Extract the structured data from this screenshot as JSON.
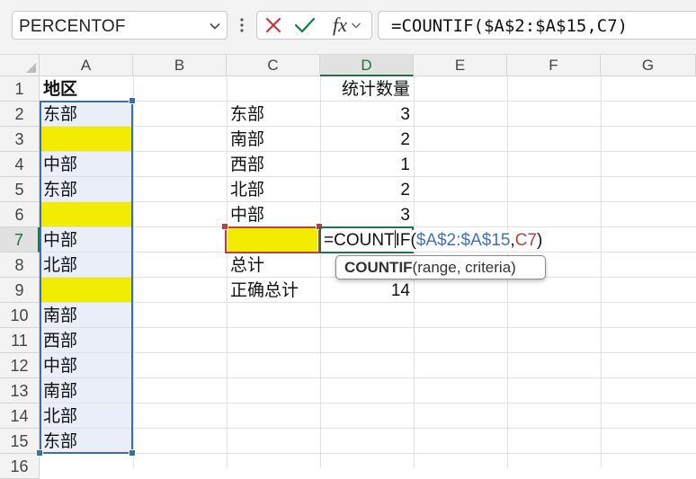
{
  "formula_bar": {
    "name_box": "PERCENTOF",
    "fx_label": "fx",
    "formula": "=COUNTIF($A$2:$A$15,C7)",
    "icons": [
      "chevron-down-icon",
      "more-vertical-icon",
      "cancel-x-icon",
      "enter-check-icon",
      "insert-function-icon"
    ]
  },
  "columns": [
    "A",
    "B",
    "C",
    "D",
    "E",
    "F",
    "G"
  ],
  "rows": [
    "1",
    "2",
    "3",
    "4",
    "5",
    "6",
    "7",
    "8",
    "9",
    "10",
    "11",
    "12",
    "13",
    "14",
    "15",
    "16"
  ],
  "column_a": {
    "header": "地区",
    "values": [
      "东部",
      "",
      "中部",
      "东部",
      "",
      "中部",
      "北部",
      "",
      "南部",
      "西部",
      "中部",
      "南部",
      "北部",
      "东部"
    ]
  },
  "summary": {
    "count_header": "统计数量",
    "regions": [
      {
        "name": "东部",
        "count": "3"
      },
      {
        "name": "南部",
        "count": "2"
      },
      {
        "name": "西部",
        "count": "1"
      },
      {
        "name": "北部",
        "count": "2"
      },
      {
        "name": "中部",
        "count": "3"
      }
    ],
    "total_label": "总计",
    "correct_total_label": "正确总计",
    "correct_total_value": "14"
  },
  "editing": {
    "prefix": "=COUNT",
    "mid": "IF(",
    "range_ref": "$A$2:$A$15",
    "comma": ",",
    "cell_ref": "C7",
    "close": ")"
  },
  "tooltip": {
    "function_name": "COUNTIF",
    "args": "(range, criteria)"
  },
  "colors": {
    "blank_highlight": "#f2ec00",
    "range_fill": "#e9eef9",
    "range_ref": "#3f72b5",
    "cell_ref": "#b84040",
    "selection_green": "#217346"
  }
}
